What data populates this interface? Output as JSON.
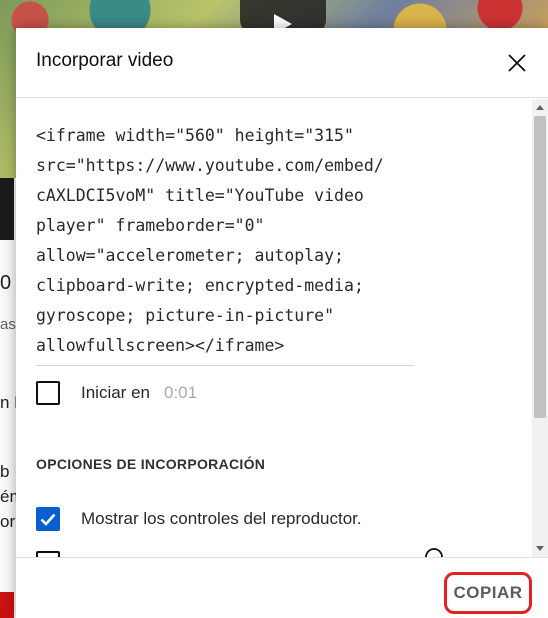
{
  "dialog": {
    "title": "Incorporar video",
    "close_icon": "close-icon"
  },
  "embed_code": "<iframe width=\"560\" height=\"315\"\nsrc=\"https://www.youtube.com/embed/\ncAXLDCI5voM\" title=\"YouTube video\nplayer\" frameborder=\"0\"\nallow=\"accelerometer; autoplay;\nclipboard-write; encrypted-media;\ngyroscope; picture-in-picture\"\nallowfullscreen></iframe>",
  "start_at": {
    "label": "Iniciar en",
    "time": "0:01",
    "checked": false
  },
  "embed_options": {
    "title": "OPCIONES DE INCORPORACIÓN",
    "items": [
      {
        "label": "Mostrar los controles del reproductor.",
        "checked": true
      }
    ]
  },
  "footer": {
    "copy_label": "COPIAR"
  },
  "background": {
    "fragments": [
      "0",
      "as",
      "n F",
      "b",
      "ém",
      "or"
    ]
  },
  "colors": {
    "accent": "#065fd4",
    "highlight_border": "#e52222"
  }
}
